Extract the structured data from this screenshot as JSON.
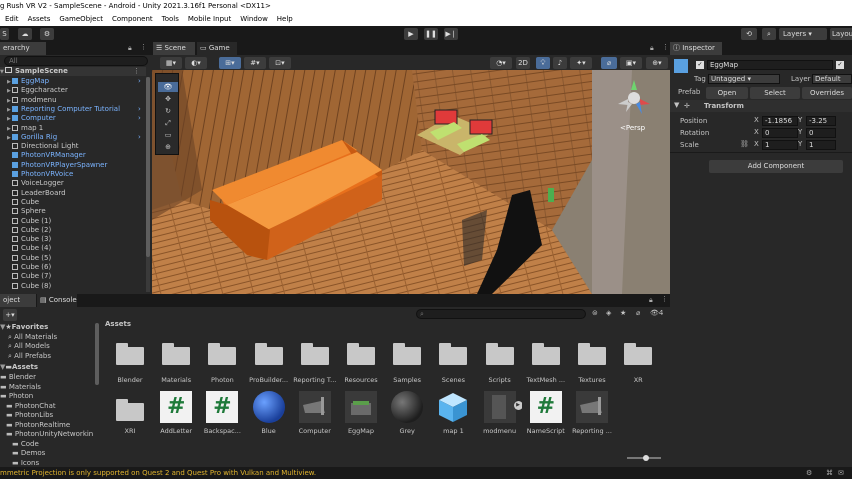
{
  "window": {
    "title": "g Rush VR V2 - SampleScene - Android - Unity 2021.3.16f1 Personal <DX11>"
  },
  "menu": [
    "Edit",
    "Assets",
    "GameObject",
    "Component",
    "Tools",
    "Mobile Input",
    "Window",
    "Help"
  ],
  "toolbar": {
    "account": "S",
    "layers": "Layers",
    "layout": "Layou"
  },
  "hierarchy": {
    "tab": "erarchy",
    "search_placeholder": "All",
    "scene": "SampleScene",
    "items": [
      {
        "label": "EggMap",
        "blue": true,
        "arrow": true
      },
      {
        "label": "Eggcharacter",
        "blue": false,
        "arrow": true
      },
      {
        "label": "modmenu",
        "blue": false,
        "arrow": true
      },
      {
        "label": "Reporting Computer Tutorial",
        "blue": true,
        "arrow": true
      },
      {
        "label": "Computer",
        "blue": true,
        "arrow": true
      },
      {
        "label": "map 1",
        "blue": false,
        "arrow": true
      },
      {
        "label": "Gorilla Rig",
        "blue": true,
        "arrow": true
      },
      {
        "label": "Directional Light",
        "blue": false,
        "arrow": false
      },
      {
        "label": "PhotonVRManager",
        "blue": true,
        "arrow": false
      },
      {
        "label": "PhotonVRPlayerSpawner",
        "blue": true,
        "arrow": false
      },
      {
        "label": "PhotonVRVoice",
        "blue": true,
        "arrow": false
      },
      {
        "label": "VoiceLogger",
        "blue": false,
        "arrow": false
      },
      {
        "label": "LeaderBoard",
        "blue": false,
        "arrow": false
      },
      {
        "label": "Cube",
        "blue": false,
        "arrow": false
      },
      {
        "label": "Sphere",
        "blue": false,
        "arrow": false
      },
      {
        "label": "Cube (1)",
        "blue": false,
        "arrow": false
      },
      {
        "label": "Cube (2)",
        "blue": false,
        "arrow": false
      },
      {
        "label": "Cube (3)",
        "blue": false,
        "arrow": false
      },
      {
        "label": "Cube (4)",
        "blue": false,
        "arrow": false
      },
      {
        "label": "Cube (5)",
        "blue": false,
        "arrow": false
      },
      {
        "label": "Cube (6)",
        "blue": false,
        "arrow": false
      },
      {
        "label": "Cube (7)",
        "blue": false,
        "arrow": false
      },
      {
        "label": "Cube (8)",
        "blue": false,
        "arrow": false
      }
    ]
  },
  "scene": {
    "tab_scene": "Scene",
    "tab_game": "Game",
    "mode_2d": "2D",
    "persp": "<Persp"
  },
  "inspector": {
    "tab": "Inspector",
    "object_name": "EggMap",
    "tag_label": "Tag",
    "tag_value": "Untagged",
    "layer_label": "Layer",
    "layer_value": "Default",
    "prefab_label": "Prefab",
    "open": "Open",
    "select": "Select",
    "overrides": "Overrides",
    "component": "Transform",
    "position_label": "Position",
    "rotation_label": "Rotation",
    "scale_label": "Scale",
    "pos_x": "-1.1856",
    "pos_y": "-3.25",
    "rot_x": "0",
    "rot_y": "0",
    "scale_x": "1",
    "scale_y": "1",
    "axis_x": "X",
    "axis_y": "Y",
    "add_component": "Add Component"
  },
  "project": {
    "tab_project": "oject",
    "tab_console": "Console",
    "assets_header": "Assets",
    "favorites": "Favorites",
    "fav_items": [
      "All Materials",
      "All Models",
      "All Prefabs"
    ],
    "assets_root": "Assets",
    "tree": [
      {
        "label": "Blender",
        "indent": 0
      },
      {
        "label": "Materials",
        "indent": 0
      },
      {
        "label": "Photon",
        "indent": 0
      },
      {
        "label": "PhotonChat",
        "indent": 1
      },
      {
        "label": "PhotonLibs",
        "indent": 1
      },
      {
        "label": "PhotonRealtime",
        "indent": 1
      },
      {
        "label": "PhotonUnityNetworkin",
        "indent": 1
      },
      {
        "label": "Code",
        "indent": 2
      },
      {
        "label": "Demos",
        "indent": 2
      },
      {
        "label": "Icons",
        "indent": 2
      }
    ],
    "count": "4",
    "row1": [
      "Blender",
      "Materials",
      "Photon",
      "ProBuilder...",
      "Reporting T...",
      "Resources",
      "Samples",
      "Scenes",
      "Scripts",
      "TextMesh ...",
      "Textures",
      "XR"
    ],
    "row2": [
      {
        "label": "XRI",
        "kind": "folder"
      },
      {
        "label": "AddLetter",
        "kind": "script"
      },
      {
        "label": "Backspac...",
        "kind": "script"
      },
      {
        "label": "Blue",
        "kind": "sphere-blue"
      },
      {
        "label": "Computer",
        "kind": "prefab"
      },
      {
        "label": "EggMap",
        "kind": "prefab-green"
      },
      {
        "label": "Grey",
        "kind": "sphere-grey"
      },
      {
        "label": "map 1",
        "kind": "cube"
      },
      {
        "label": "modmenu",
        "kind": "prefab-dark"
      },
      {
        "label": "NameScript",
        "kind": "script"
      },
      {
        "label": "Reporting ...",
        "kind": "prefab"
      }
    ]
  },
  "status": {
    "message": "mmetric Projection is only supported on Quest 2 and Quest Pro with Vulkan and Multiview."
  },
  "colors": {
    "accent_blue": "#7bb4ff",
    "warning": "#e2b52e",
    "couch": "#e8701c"
  }
}
